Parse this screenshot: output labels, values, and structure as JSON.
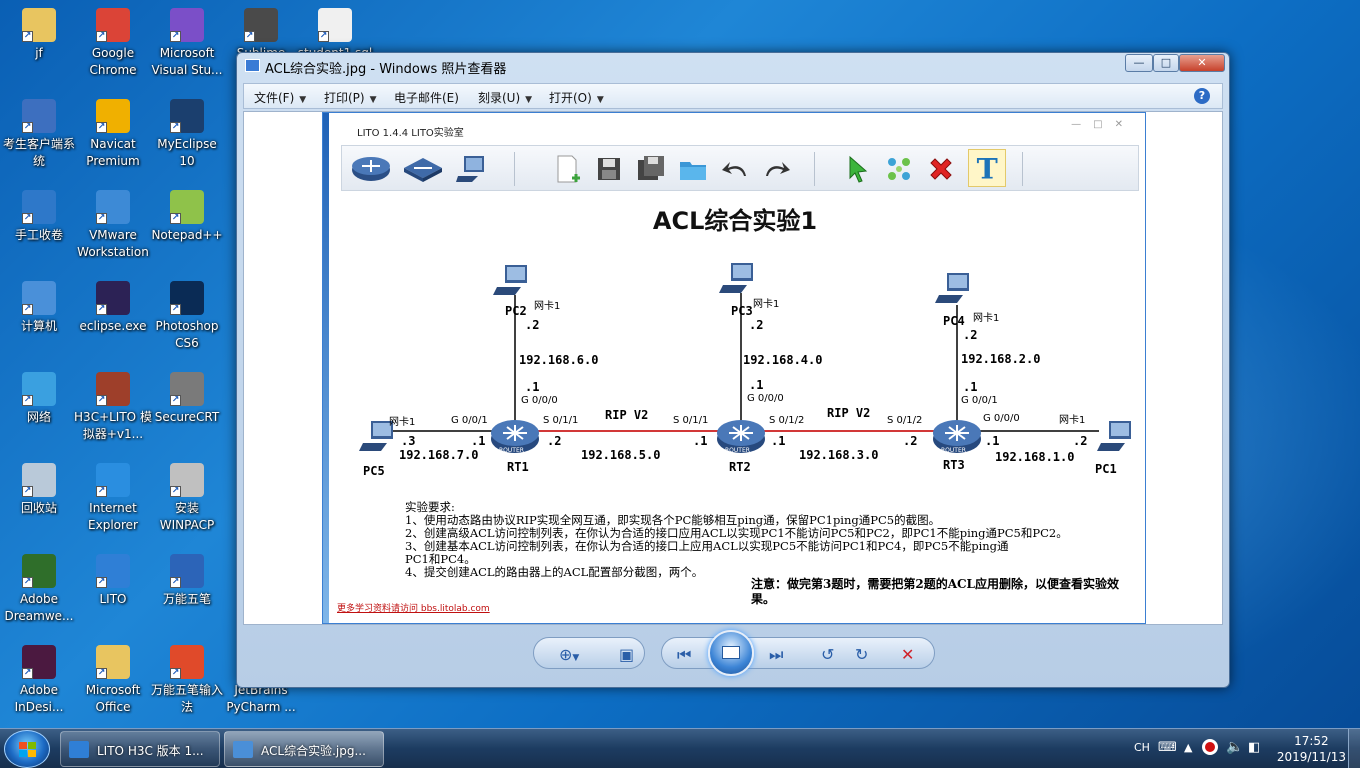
{
  "desktop": {
    "icons": [
      {
        "label": "jf",
        "color": "#e8c560"
      },
      {
        "label": "Google Chrome",
        "color": "#db4437"
      },
      {
        "label": "Microsoft Visual Stu...",
        "color": "#7b4fc8"
      },
      {
        "label": "Sublime",
        "color": "#4a4a4a"
      },
      {
        "label": "student1.sql",
        "color": "#f0f0f0"
      },
      {
        "label": "考生客户端系统",
        "color": "#3d6fbf"
      },
      {
        "label": "Navicat Premium",
        "color": "#f0b000"
      },
      {
        "label": "MyEclipse 10",
        "color": "#1b3f6e"
      },
      {
        "label": "手工收卷",
        "color": "#2e78c9"
      },
      {
        "label": "VMware Workstation",
        "color": "#3d8ad6"
      },
      {
        "label": "Notepad++",
        "color": "#8fc24a"
      },
      {
        "label": "计算机",
        "color": "#4a90d9"
      },
      {
        "label": "eclipse.exe",
        "color": "#2c2255"
      },
      {
        "label": "Photoshop CS6",
        "color": "#0a2b55"
      },
      {
        "label": "网络",
        "color": "#3aa0e0"
      },
      {
        "label": "H3C+LITO 模拟器+v1...",
        "color": "#9e3f2a"
      },
      {
        "label": "SecureCRT",
        "color": "#7a7a7a"
      },
      {
        "label": "回收站",
        "color": "#b9c9d9"
      },
      {
        "label": "Internet Explorer",
        "color": "#2a8ee0"
      },
      {
        "label": "安装WINPACP",
        "color": "#c0c0c0"
      },
      {
        "label": "Adobe Dreamwe...",
        "color": "#2f6e2a"
      },
      {
        "label": "LITO",
        "color": "#2f7fd6"
      },
      {
        "label": "万能五笔",
        "color": "#2c64b8"
      },
      {
        "label": "Adobe InDesi...",
        "color": "#4b1940"
      },
      {
        "label": "Microsoft Office",
        "color": "#e8c560"
      },
      {
        "label": "万能五笔输入法",
        "color": "#e04a2a"
      },
      {
        "label": "JetBrains PyCharm ...",
        "color": "#3a6a5a"
      }
    ]
  },
  "viewer": {
    "title": "ACL综合实验.jpg - Windows 照片查看器",
    "menu": [
      "文件(F)",
      "打印(P)",
      "电子邮件(E)",
      "刻录(U)",
      "打开(O)"
    ],
    "help": "?"
  },
  "inner": {
    "app_title": "LITO 1.4.4  LITO实验室",
    "diagram_title": "ACL综合实验1",
    "hosts": {
      "pc1": "PC1",
      "pc2": "PC2",
      "pc3": "PC3",
      "pc4": "PC4",
      "pc5": "PC5"
    },
    "routers": {
      "rt1": "RT1",
      "rt2": "RT2",
      "rt3": "RT3",
      "router_word": "ROUTER"
    },
    "nic": "网卡1",
    "nets": {
      "n6": "192.168.6.0",
      "n4": "192.168.4.0",
      "n2": "192.168.2.0",
      "n7": "192.168.7.0",
      "n5": "192.168.5.0",
      "n3": "192.168.3.0",
      "n1": "192.168.1.0"
    },
    "ifaces": {
      "rt1_up": "G 0/0/0",
      "rt1_left": "G 0/0/1",
      "rt1_right": "S 0/1/1",
      "rt2_left": "S 0/1/1",
      "rt2_up": "G 0/0/0",
      "rt2_right": "S 0/1/2",
      "rt3_left": "S 0/1/2",
      "rt3_up": "G 0/0/1",
      "rt3_right": "G 0/0/0"
    },
    "hosts_addr": {
      ".2": ".2",
      ".1": ".1",
      ".3": ".3"
    },
    "rip": "RIP V2",
    "requirements": [
      "实验要求:",
      "1、使用动态路由协议RIP实现全网互通，即实现各个PC能够相互ping通，保留PC1ping通PC5的截图。",
      "2、创建高级ACL访问控制列表，在你认为合适的接口应用ACL以实现PC1不能访问PC5和PC2，即PC1不能ping通PC5和PC2。",
      "3、创建基本ACL访问控制列表，在你认为合适的接口上应用ACL以实现PC5不能访问PC1和PC4，即PC5不能ping通",
      "PC1和PC4。",
      "4、提交创建ACL的路由器上的ACL配置部分截图，两个。"
    ],
    "note": "注意：做完第3题时，需要把第2题的ACL应用删除，以便查看实验效果。",
    "footer": "更多学习资料请访问 bbs.litolab.com"
  },
  "taskbar": {
    "tasks": [
      {
        "label": "LITO H3C 版本 1...",
        "color": "#2f7fd6",
        "active": false
      },
      {
        "label": "ACL综合实验.jpg...",
        "color": "#4a8fd8",
        "active": true
      }
    ],
    "lang": "CH",
    "time": "17:52",
    "date": "2019/11/13"
  }
}
